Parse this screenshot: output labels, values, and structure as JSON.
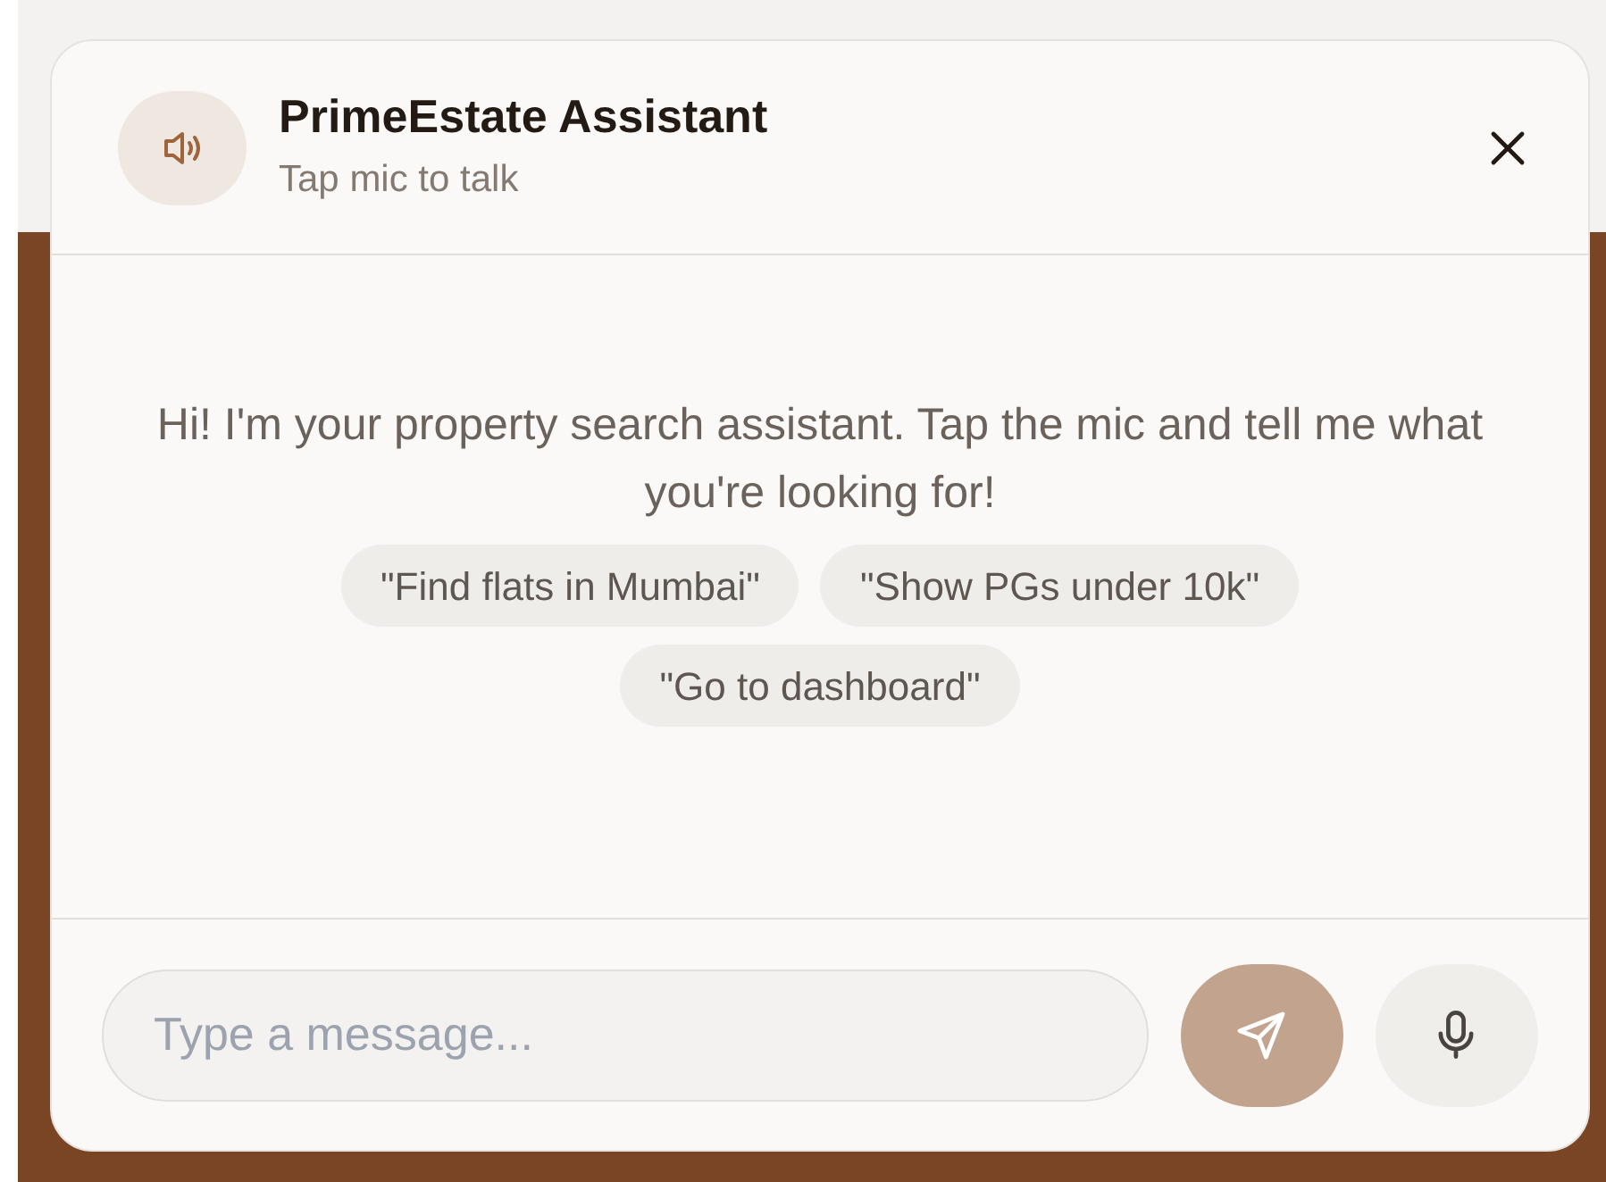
{
  "header": {
    "title": "PrimeEstate Assistant",
    "subtitle": "Tap mic to talk"
  },
  "greeting": "Hi! I'm your property search assistant. Tap the mic and tell me what you're looking for!",
  "suggestions": [
    "\"Find flats in Mumbai\"",
    "\"Show PGs under 10k\"",
    "\"Go to dashboard\""
  ],
  "composer": {
    "placeholder": "Type a message..."
  }
}
